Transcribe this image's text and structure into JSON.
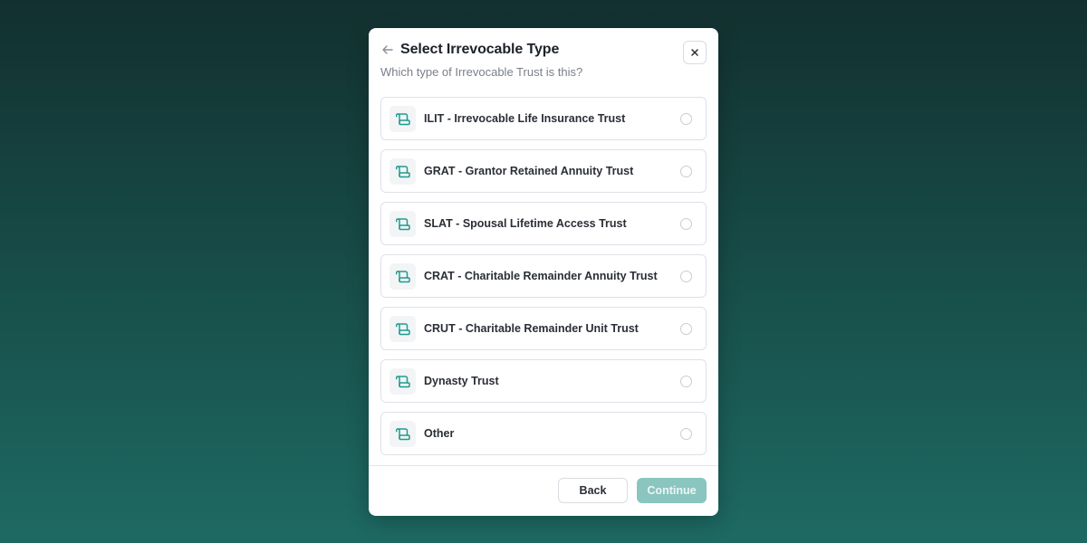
{
  "modal": {
    "title": "Select Irrevocable Type",
    "subtitle": "Which type of Irrevocable Trust is this?",
    "back_icon": "arrow-left-icon",
    "close_icon": "close-icon"
  },
  "options": [
    {
      "label": "ILIT - Irrevocable Life Insurance Trust",
      "icon": "scroll-icon",
      "selected": false
    },
    {
      "label": "GRAT - Grantor Retained Annuity Trust",
      "icon": "scroll-icon",
      "selected": false
    },
    {
      "label": "SLAT - Spousal Lifetime Access Trust",
      "icon": "scroll-icon",
      "selected": false
    },
    {
      "label": "CRAT - Charitable Remainder Annuity Trust",
      "icon": "scroll-icon",
      "selected": false
    },
    {
      "label": "CRUT - Charitable Remainder Unit Trust",
      "icon": "scroll-icon",
      "selected": false
    },
    {
      "label": "Dynasty Trust",
      "icon": "scroll-icon",
      "selected": false
    },
    {
      "label": "Other",
      "icon": "scroll-icon",
      "selected": false
    }
  ],
  "footer": {
    "back_label": "Back",
    "continue_label": "Continue",
    "continue_disabled": true
  },
  "colors": {
    "accent": "#1f9b8d",
    "continue_disabled_bg": "#8ac5bf",
    "background_top": "#12302f",
    "background_bottom": "#1e6a63"
  }
}
